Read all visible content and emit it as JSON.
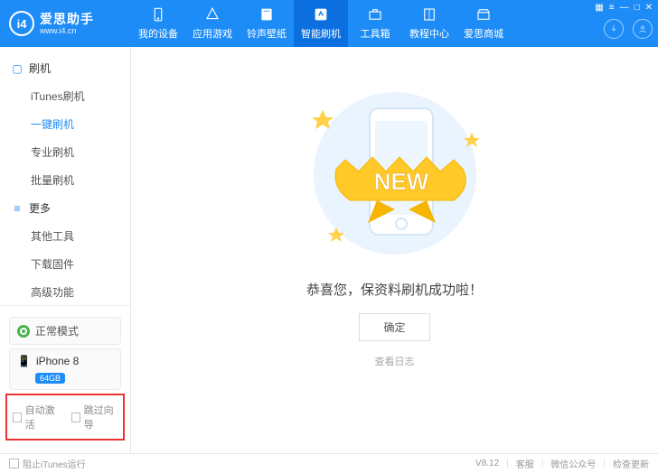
{
  "app": {
    "name": "爱思助手",
    "url": "www.i4.cn",
    "logo_letters": "i4"
  },
  "window_controls": [
    "▦",
    "≡",
    "—",
    "□",
    "✕"
  ],
  "nav": [
    {
      "key": "device",
      "label": "我的设备"
    },
    {
      "key": "apps",
      "label": "应用游戏"
    },
    {
      "key": "ring",
      "label": "铃声壁纸"
    },
    {
      "key": "flash",
      "label": "智能刷机",
      "active": true
    },
    {
      "key": "toolbox",
      "label": "工具箱"
    },
    {
      "key": "tutorial",
      "label": "教程中心"
    },
    {
      "key": "store",
      "label": "爱思商城"
    }
  ],
  "sidebar": {
    "section1": {
      "title": "刷机",
      "items": [
        {
          "label": "iTunes刷机"
        },
        {
          "label": "一键刷机",
          "active": true
        },
        {
          "label": "专业刷机"
        },
        {
          "label": "批量刷机"
        }
      ]
    },
    "section2": {
      "title": "更多",
      "items": [
        {
          "label": "其他工具"
        },
        {
          "label": "下载固件"
        },
        {
          "label": "高级功能"
        }
      ]
    },
    "mode": {
      "label": "正常模式"
    },
    "device": {
      "name": "iPhone 8",
      "storage": "64GB"
    },
    "checks": {
      "auto_activate": "自动激活",
      "skip_setup": "跳过向导"
    }
  },
  "main": {
    "banner_text": "NEW",
    "success_msg": "恭喜您，保资料刷机成功啦！",
    "ok": "确定",
    "view_log": "查看日志"
  },
  "footer": {
    "block_itunes": "阻止iTunes运行",
    "version": "V8.12",
    "support": "客服",
    "wechat": "微信公众号",
    "update": "检查更新"
  }
}
